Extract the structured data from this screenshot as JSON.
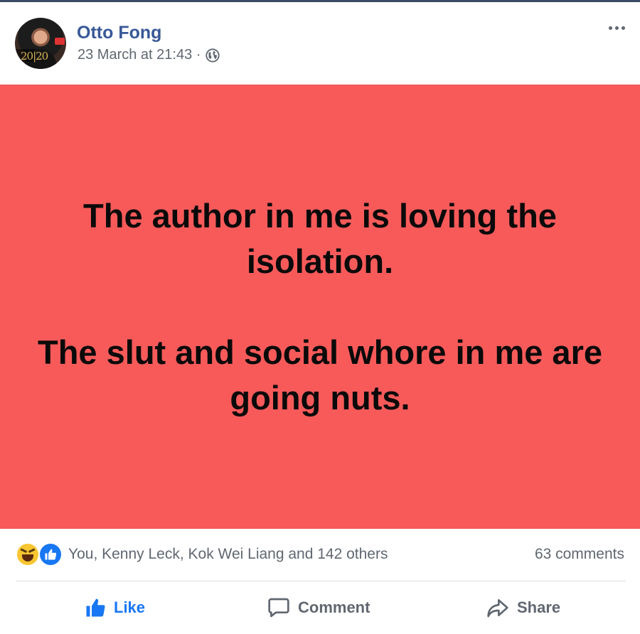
{
  "post": {
    "author": "Otto Fong",
    "timestamp": "23 March at 21:43 ·",
    "privacy_icon": "globe-icon",
    "more_icon": "more-options-icon",
    "avatar_stamp": "20|20",
    "background_color": "#f85a5a",
    "text_lines": [
      "The author in me is loving the isolation.",
      "The slut and social whore in me are going nuts."
    ]
  },
  "reactions": {
    "icons": [
      "haha-icon",
      "like-icon"
    ],
    "names": "You, Kenny Leck, Kok Wei Liang and 142 others",
    "comments": "63 comments"
  },
  "actions": {
    "like": "Like",
    "comment": "Comment",
    "share": "Share"
  },
  "colors": {
    "link_blue": "#385898",
    "like_blue": "#1877f2",
    "secondary_text": "#606770"
  }
}
